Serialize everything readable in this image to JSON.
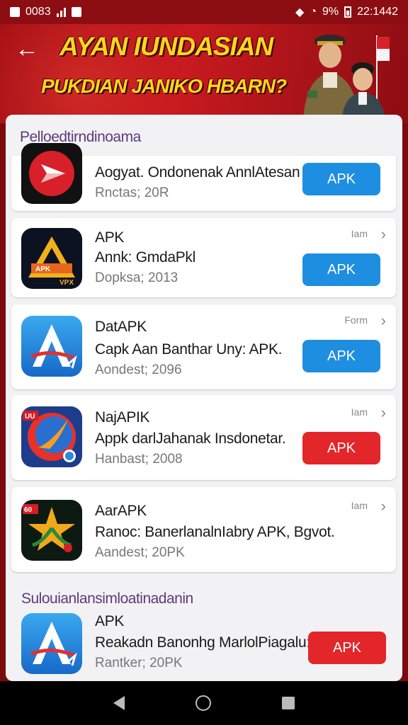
{
  "status_bar": {
    "left_text": "0083",
    "time": "22:1442",
    "battery": "9%"
  },
  "banner": {
    "title": "AYAN IUNDASIAN",
    "subtitle": "PUKDIAN JANIKO HBARN?"
  },
  "main": {
    "section_title": "Pelloedtirndinoama",
    "apps": [
      {
        "name": "",
        "desc": "Aogyat. Ondonenak AnnlAtesan",
        "meta": "Rnctas; 20R",
        "tag": "",
        "button_label": "APK",
        "button_color": "blue",
        "icon": "red-play-icon"
      },
      {
        "name": "APK",
        "desc": "Annk: GmdaPkl",
        "meta": "Dopksa; 2013",
        "tag": "Iam",
        "button_label": "APK",
        "button_color": "blue",
        "icon": "vpx-triangle-icon"
      },
      {
        "name": "DatAPK",
        "desc": "Capk Aan Banthar Uny: APK.",
        "meta": "Aondest; 2096",
        "tag": "Form",
        "button_label": "APK",
        "button_color": "blue",
        "icon": "blue-a-icon"
      },
      {
        "name": "NajAPIK",
        "desc": "Appk darlJahanak Insdonetar.",
        "meta": "Hanbast; 2008",
        "tag": "Iam",
        "button_label": "APK",
        "button_color": "red",
        "icon": "bird-logo-icon"
      },
      {
        "name": "AarAPK",
        "desc": "Ranoc: BanerlanalnIabry APK, Bgvot.",
        "meta": "Aandest; 20PK",
        "tag": "Iam",
        "button_label": "APK",
        "button_color": "red",
        "icon": "star-leaf-icon"
      }
    ],
    "section2_title": "Sulouianlansimloatinadanin",
    "section2_app": {
      "name": "APK",
      "desc": "Reakadn Banonhg MarlolPiagalu:",
      "meta": "Rantker; 20PK",
      "button_label": "APK",
      "button_color": "red",
      "icon": "blue-a-icon"
    }
  },
  "colors": {
    "accent_blue": "#1e8ee0",
    "accent_red": "#e3262a",
    "banner_red": "#c81a1f",
    "title_yellow": "#ffd51c"
  }
}
